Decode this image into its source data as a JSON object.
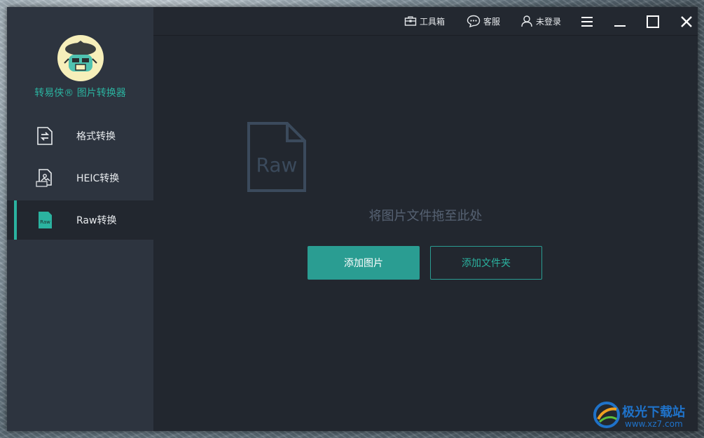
{
  "app": {
    "brand": "转易侠® 图片转换器",
    "accent_color": "#2bb3a0"
  },
  "sidebar": {
    "items": [
      {
        "label": "格式转换",
        "icon": "format-convert-icon",
        "active": false
      },
      {
        "label": "HEIC转换",
        "icon": "heic-file-icon",
        "active": false
      },
      {
        "label": "Raw转换",
        "icon": "raw-file-icon",
        "active": true
      }
    ]
  },
  "topbar": {
    "toolbox": "工具箱",
    "service": "客服",
    "login": "未登录"
  },
  "main": {
    "drop_icon_text": "Raw",
    "drop_hint": "将图片文件拖至此处",
    "add_image": "添加图片",
    "add_folder": "添加文件夹"
  },
  "watermark": {
    "name": "极光下载站",
    "url": "www.xz7.com"
  }
}
